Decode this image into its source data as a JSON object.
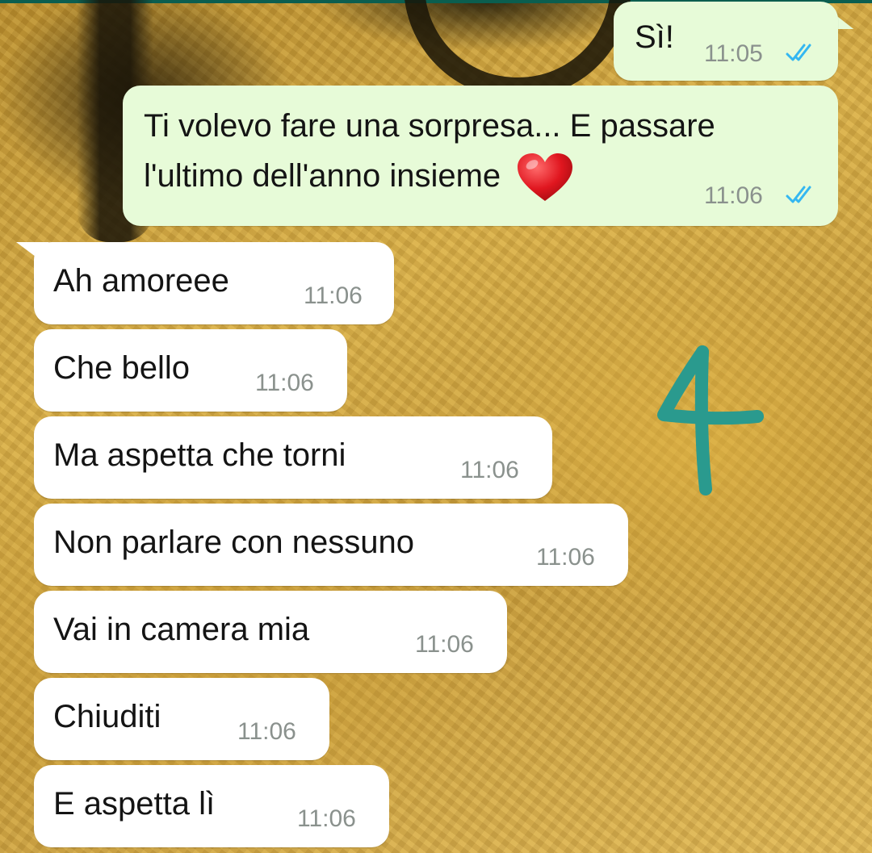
{
  "chat": {
    "messages": [
      {
        "direction": "outgoing",
        "text": "Sì!",
        "time": "11:05",
        "status": "read-double-tick"
      },
      {
        "direction": "outgoing",
        "lines": [
          "Ti volevo fare una sorpresa... E passare",
          "l'ultimo dell'anno insieme"
        ],
        "emoji": "red-heart",
        "time": "11:06",
        "status": "read-double-tick"
      },
      {
        "direction": "incoming",
        "text": "Ah amoreee",
        "time": "11:06"
      },
      {
        "direction": "incoming",
        "text": "Che bello",
        "time": "11:06"
      },
      {
        "direction": "incoming",
        "text": "Ma aspetta che torni",
        "time": "11:06"
      },
      {
        "direction": "incoming",
        "text": "Non parlare con nessuno",
        "time": "11:06"
      },
      {
        "direction": "incoming",
        "text": "Vai in camera mia",
        "time": "11:06"
      },
      {
        "direction": "incoming",
        "text": "Chiuditi",
        "time": "11:06"
      },
      {
        "direction": "incoming",
        "text": "E aspetta lì",
        "time": "11:06"
      }
    ]
  },
  "annotation": {
    "text": "4",
    "color": "#2a9a8e"
  },
  "colors": {
    "outgoing_bubble": "#e7fbd8",
    "incoming_bubble": "#ffffff",
    "timestamp": "#8a918d",
    "read_tick": "#34b7f1",
    "header_bar": "#0b5e4f"
  }
}
